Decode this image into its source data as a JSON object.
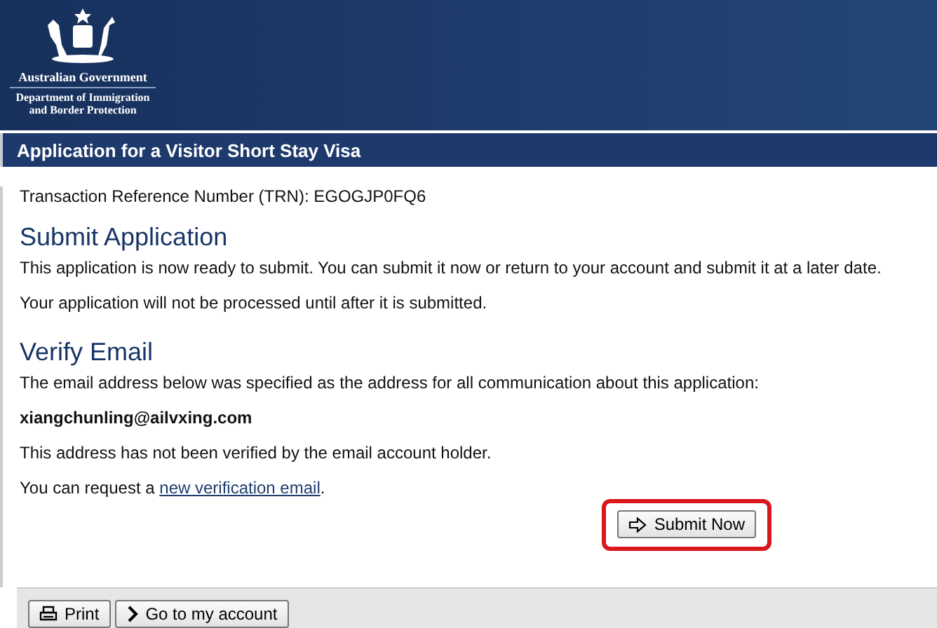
{
  "header": {
    "government": "Australian Government",
    "department": [
      "Department of Immigration",
      "and Border Protection"
    ]
  },
  "title_bar": "Application for a Visitor Short Stay Visa",
  "trn": "Transaction Reference Number (TRN): EGOGJP0FQ6",
  "sections": [
    {
      "heading": "Submit Application",
      "paragraphs": [
        {
          "text": "This application is now ready to submit. You can submit it now or return to your account and submit it at a later date."
        },
        {
          "text": "Your application will not be processed until after it is submitted."
        }
      ]
    },
    {
      "heading": "Verify Email",
      "paragraphs": [
        {
          "text": "The email address below was specified as the address for all communication about this application:"
        },
        {
          "text": "xiangchunling@ailvxing.com",
          "kind": "strong"
        },
        {
          "text": "This address has not been verified by the email account holder."
        },
        {
          "text": "You can request a ",
          "link": "new verification email",
          "after": "."
        }
      ]
    }
  ],
  "submit_button": {
    "label": "Submit Now",
    "highlighted": true
  },
  "footer_buttons": [
    {
      "label": "Print",
      "kind": "print"
    },
    {
      "label": "Go to my account",
      "kind": "next"
    }
  ]
}
